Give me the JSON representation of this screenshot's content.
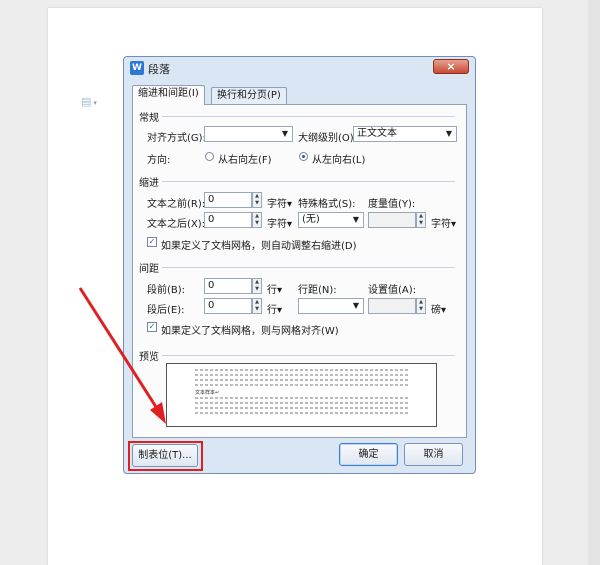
{
  "dialog": {
    "title": "段落",
    "icon": "wps-writer-icon",
    "close": "×"
  },
  "tabs": [
    {
      "label": "缩进和间距(I)"
    },
    {
      "label": "换行和分页(P)"
    }
  ],
  "general": {
    "section": "常规",
    "align_label": "对齐方式(G):",
    "align_value": "",
    "outline_label": "大纲级别(O):",
    "outline_value": "正文文本",
    "direction_label": "方向:",
    "rtl_label": "从右向左(F)",
    "ltr_label": "从左向右(L)",
    "selected_direction": "ltr"
  },
  "indent": {
    "section": "缩进",
    "before_label": "文本之前(R):",
    "before_value": "0",
    "before_unit": "字符▾",
    "after_label": "文本之后(X):",
    "after_value": "0",
    "after_unit": "字符▾",
    "special_label": "特殊格式(S):",
    "special_value": "(无)",
    "measure_label": "度量值(Y):",
    "measure_value": "",
    "measure_unit": "字符▾",
    "grid_check_label": "如果定义了文档网格，则自动调整右缩进(D)",
    "grid_checked": true
  },
  "spacing": {
    "section": "间距",
    "before_label": "段前(B):",
    "before_value": "0",
    "before_unit": "行▾",
    "after_label": "段后(E):",
    "after_value": "0",
    "after_unit": "行▾",
    "line_label": "行距(N):",
    "line_value": "",
    "setting_label": "设置值(A):",
    "setting_value": "",
    "setting_unit": "磅▾",
    "grid_check_label": "如果定义了文档网格，则与网格对齐(W)",
    "grid_checked": true
  },
  "preview": {
    "section": "预览",
    "sample": "文本样本↵"
  },
  "buttons": {
    "tabs": "制表位(T)...",
    "ok": "确定",
    "cancel": "取消"
  },
  "annotation": {
    "highlight_color": "#e02020"
  }
}
